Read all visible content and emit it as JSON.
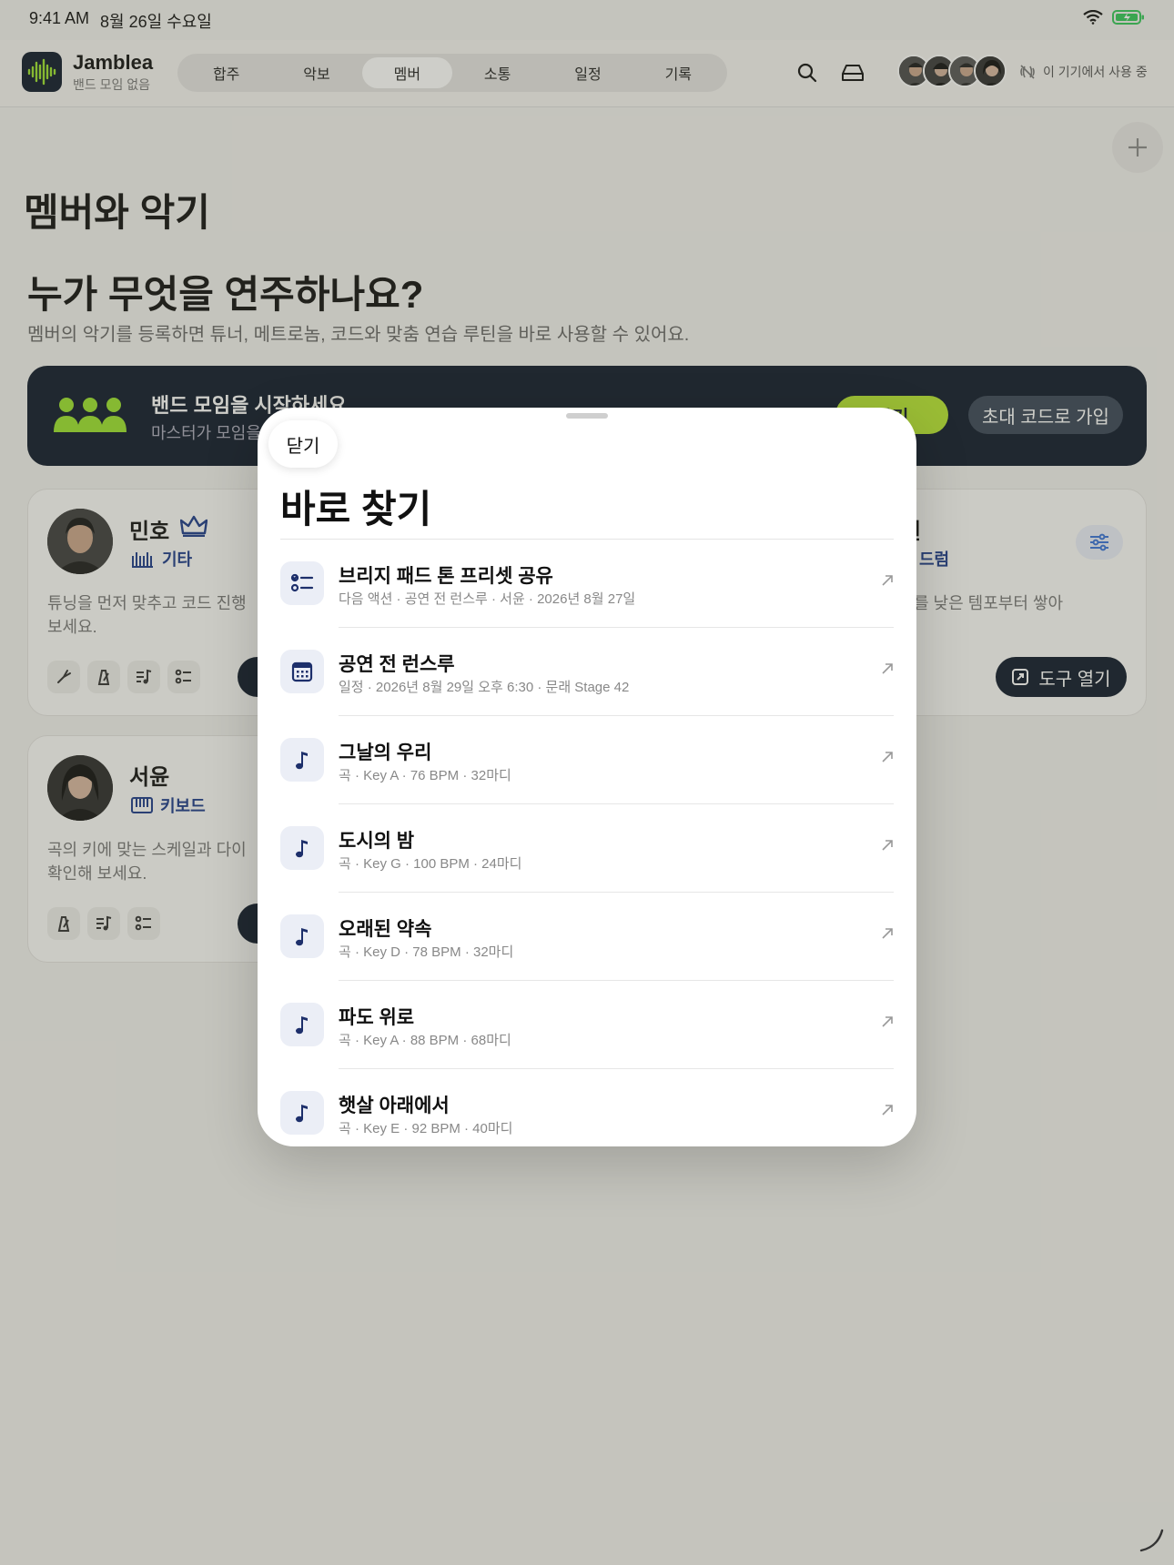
{
  "status_bar": {
    "time": "9:41 AM",
    "date": "8월 26일 수요일"
  },
  "app": {
    "name": "Jamblea",
    "subtitle": "밴드 모임 없음"
  },
  "nav": {
    "tabs": [
      {
        "label": "합주"
      },
      {
        "label": "악보"
      },
      {
        "label": "멤버",
        "active": true
      },
      {
        "label": "소통"
      },
      {
        "label": "일정"
      },
      {
        "label": "기록"
      }
    ]
  },
  "header": {
    "device_status": "이 기기에서 사용 중"
  },
  "page": {
    "title": "멤버와 악기",
    "section_title": "누가 무엇을 연주하나요?",
    "section_subtitle": "멤버의 악기를 등록하면 튜너, 메트로놈, 코드와 맞춤 연습 루틴을 바로 사용할 수 있어요."
  },
  "banner": {
    "title": "밴드 모임을 시작하세요",
    "subtitle": "마스터가 모임을",
    "make_button": "들기",
    "join_button": "초대 코드로 가입"
  },
  "members": [
    {
      "name": "민호",
      "instrument": "기타",
      "desc_line1": "튜닝을 먼저 맞추고 코드 진행",
      "desc_line2": "보세요."
    },
    {
      "name": "서윤",
      "instrument": "키보드",
      "desc_line1": "곡의 키에 맞는 스케일과 다이",
      "desc_line2": "확인해 보세요."
    },
    {
      "name_fragment": "현",
      "instrument_fragment": "드럼",
      "desc_fragment": "를 낮은 템포부터 쌓아",
      "tools_button": "도구 열기"
    }
  ],
  "sheet": {
    "close_label": "닫기",
    "title": "바로 찾기",
    "items": [
      {
        "icon": "checklist-icon",
        "title": "브리지 패드 톤 프리셋 공유",
        "subtitle": "다음 액션 · 공연 전 런스루 · 서윤 · 2026년 8월 27일"
      },
      {
        "icon": "calendar-icon",
        "title": "공연 전 런스루",
        "subtitle": "일정 · 2026년 8월 29일 오후 6:30 · 문래 Stage 42"
      },
      {
        "icon": "music-note-icon",
        "title": "그날의 우리",
        "subtitle": "곡 · Key A · 76 BPM · 32마디"
      },
      {
        "icon": "music-note-icon",
        "title": "도시의 밤",
        "subtitle": "곡 · Key G · 100 BPM · 24마디"
      },
      {
        "icon": "music-note-icon",
        "title": "오래된 약속",
        "subtitle": "곡 · Key D · 78 BPM · 32마디"
      },
      {
        "icon": "music-note-icon",
        "title": "파도 위로",
        "subtitle": "곡 · Key A · 88 BPM · 68마디"
      },
      {
        "icon": "music-note-icon",
        "title": "햇살 아래에서",
        "subtitle": "곡 · Key E · 92 BPM · 40마디"
      }
    ]
  },
  "colors": {
    "accent_green": "#b8e632",
    "navy": "#0f1a2b",
    "instrument_blue": "#1d3b8a"
  }
}
